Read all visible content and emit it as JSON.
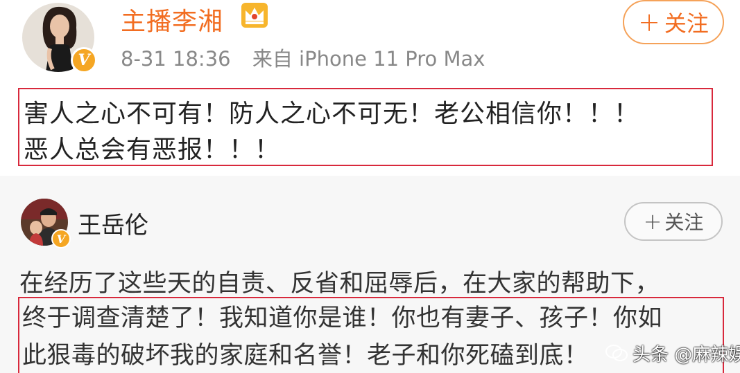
{
  "post1": {
    "author": "主播李湘",
    "timestamp": "8-31 18:36",
    "source": "来自 iPhone 11 Pro Max",
    "follow_plus": "+",
    "follow_label": "关注",
    "content_line1": "害人之心不可有！防人之心不可无！老公相信你！！！",
    "content_line2": "恶人总会有恶报！！！",
    "badge_letter": "V"
  },
  "post2": {
    "author": "王岳伦",
    "follow_plus": "+",
    "follow_label": "关注",
    "line1": "在经历了这些天的自责、反省和屈辱后，在大家的帮助下，",
    "line2": "终于调查清楚了！我知道你是谁！你也有妻子、孩子！你如",
    "line3": "此狠毒的破坏我的家庭和名誉！老子和你死磕到底！",
    "badge_letter": "V"
  },
  "watermark": {
    "text": "头条 @麻辣娱哥"
  },
  "colors": {
    "accent_orange": "#f26d21",
    "highlight_red": "#d8293c",
    "verified_gold": "#f5a623"
  },
  "icons": {
    "crown": "crown-icon",
    "verified": "verified-badge-icon",
    "watermark": "weixin-icon"
  }
}
